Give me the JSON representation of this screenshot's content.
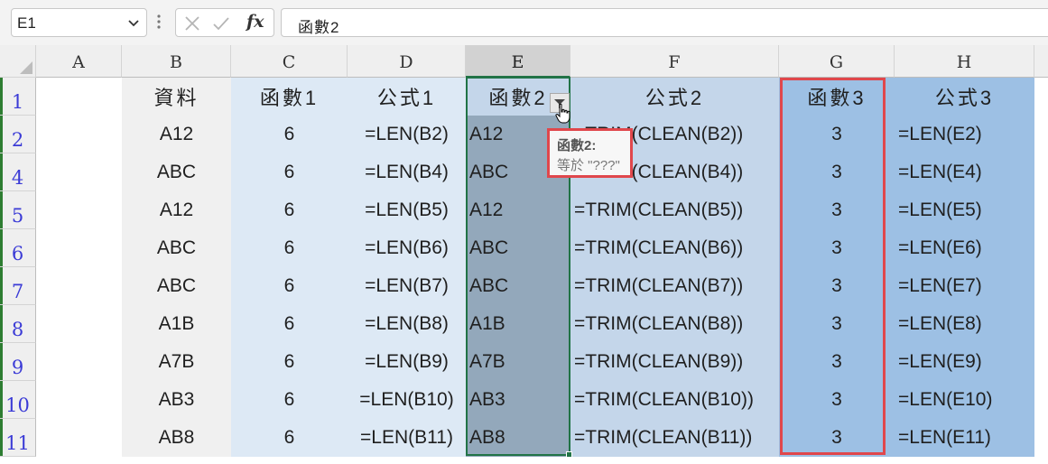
{
  "formula_bar": {
    "name_box": "E1",
    "formula": "函數2",
    "fx_label": "fx",
    "icons": [
      "chevron-down-icon",
      "more-dots-icon",
      "cancel-x-icon",
      "enter-check-icon",
      "function-fx-icon"
    ]
  },
  "columns": [
    "A",
    "B",
    "C",
    "D",
    "E",
    "F",
    "G",
    "H"
  ],
  "selected_column": "E",
  "rows": [
    "1",
    "2",
    "4",
    "5",
    "6",
    "7",
    "8",
    "9",
    "10",
    "11"
  ],
  "headers": {
    "B": "資料",
    "C": "函數1",
    "D": "公式1",
    "E": "函數2",
    "F": "公式2",
    "G": "函數3",
    "H": "公式3"
  },
  "data_rows": [
    {
      "B": "A12",
      "C": "6",
      "D": "=LEN(B2)",
      "E": "A12",
      "F": "=TRIM(CLEAN(B2))",
      "G": "3",
      "H": "=LEN(E2)"
    },
    {
      "B": "ABC",
      "C": "6",
      "D": "=LEN(B4)",
      "E": "ABC",
      "F": "=TRIM(CLEAN(B4))",
      "G": "3",
      "H": "=LEN(E4)"
    },
    {
      "B": "A12",
      "C": "6",
      "D": "=LEN(B5)",
      "E": "A12",
      "F": "=TRIM(CLEAN(B5))",
      "G": "3",
      "H": "=LEN(E5)"
    },
    {
      "B": "ABC",
      "C": "6",
      "D": "=LEN(B6)",
      "E": "ABC",
      "F": "=TRIM(CLEAN(B6))",
      "G": "3",
      "H": "=LEN(E6)"
    },
    {
      "B": "ABC",
      "C": "6",
      "D": "=LEN(B7)",
      "E": "ABC",
      "F": "=TRIM(CLEAN(B7))",
      "G": "3",
      "H": "=LEN(E7)"
    },
    {
      "B": "A1B",
      "C": "6",
      "D": "=LEN(B8)",
      "E": "A1B",
      "F": "=TRIM(CLEAN(B8))",
      "G": "3",
      "H": "=LEN(E8)"
    },
    {
      "B": "A7B",
      "C": "6",
      "D": "=LEN(B9)",
      "E": "A7B",
      "F": "=TRIM(CLEAN(B9))",
      "G": "3",
      "H": "=LEN(E9)"
    },
    {
      "B": "AB3",
      "C": "6",
      "D": "=LEN(B10)",
      "E": "AB3",
      "F": "=TRIM(CLEAN(B10))",
      "G": "3",
      "H": "=LEN(E10)"
    },
    {
      "B": "AB8",
      "C": "6",
      "D": "=LEN(B11)",
      "E": "AB8",
      "F": "=TRIM(CLEAN(B11))",
      "G": "3",
      "H": "=LEN(E11)"
    }
  ],
  "filter_tooltip": {
    "title": "函數2:",
    "condition": "等於 \"???\""
  },
  "colors": {
    "selection_border": "#217346",
    "highlight_border": "#e0474c",
    "row_number_text": "#3b3bd6"
  }
}
